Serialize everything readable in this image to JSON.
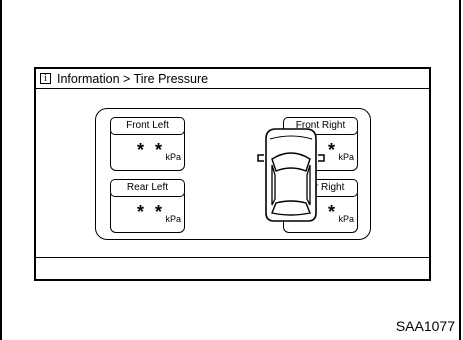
{
  "header": {
    "info_icon": "i",
    "breadcrumb": "Information > Tire Pressure"
  },
  "tires": {
    "front_left": {
      "label": "Front Left",
      "value": "* *",
      "unit": "kPa"
    },
    "front_right": {
      "label": "Front Right",
      "value": "* *",
      "unit": "kPa"
    },
    "rear_left": {
      "label": "Rear Left",
      "value": "* *",
      "unit": "kPa"
    },
    "rear_right": {
      "label": "Rear Right",
      "value": "* *",
      "unit": "kPa"
    }
  },
  "caption": "SAA1077",
  "icons": {
    "info": "info-icon",
    "car": "car-top-view-icon"
  }
}
